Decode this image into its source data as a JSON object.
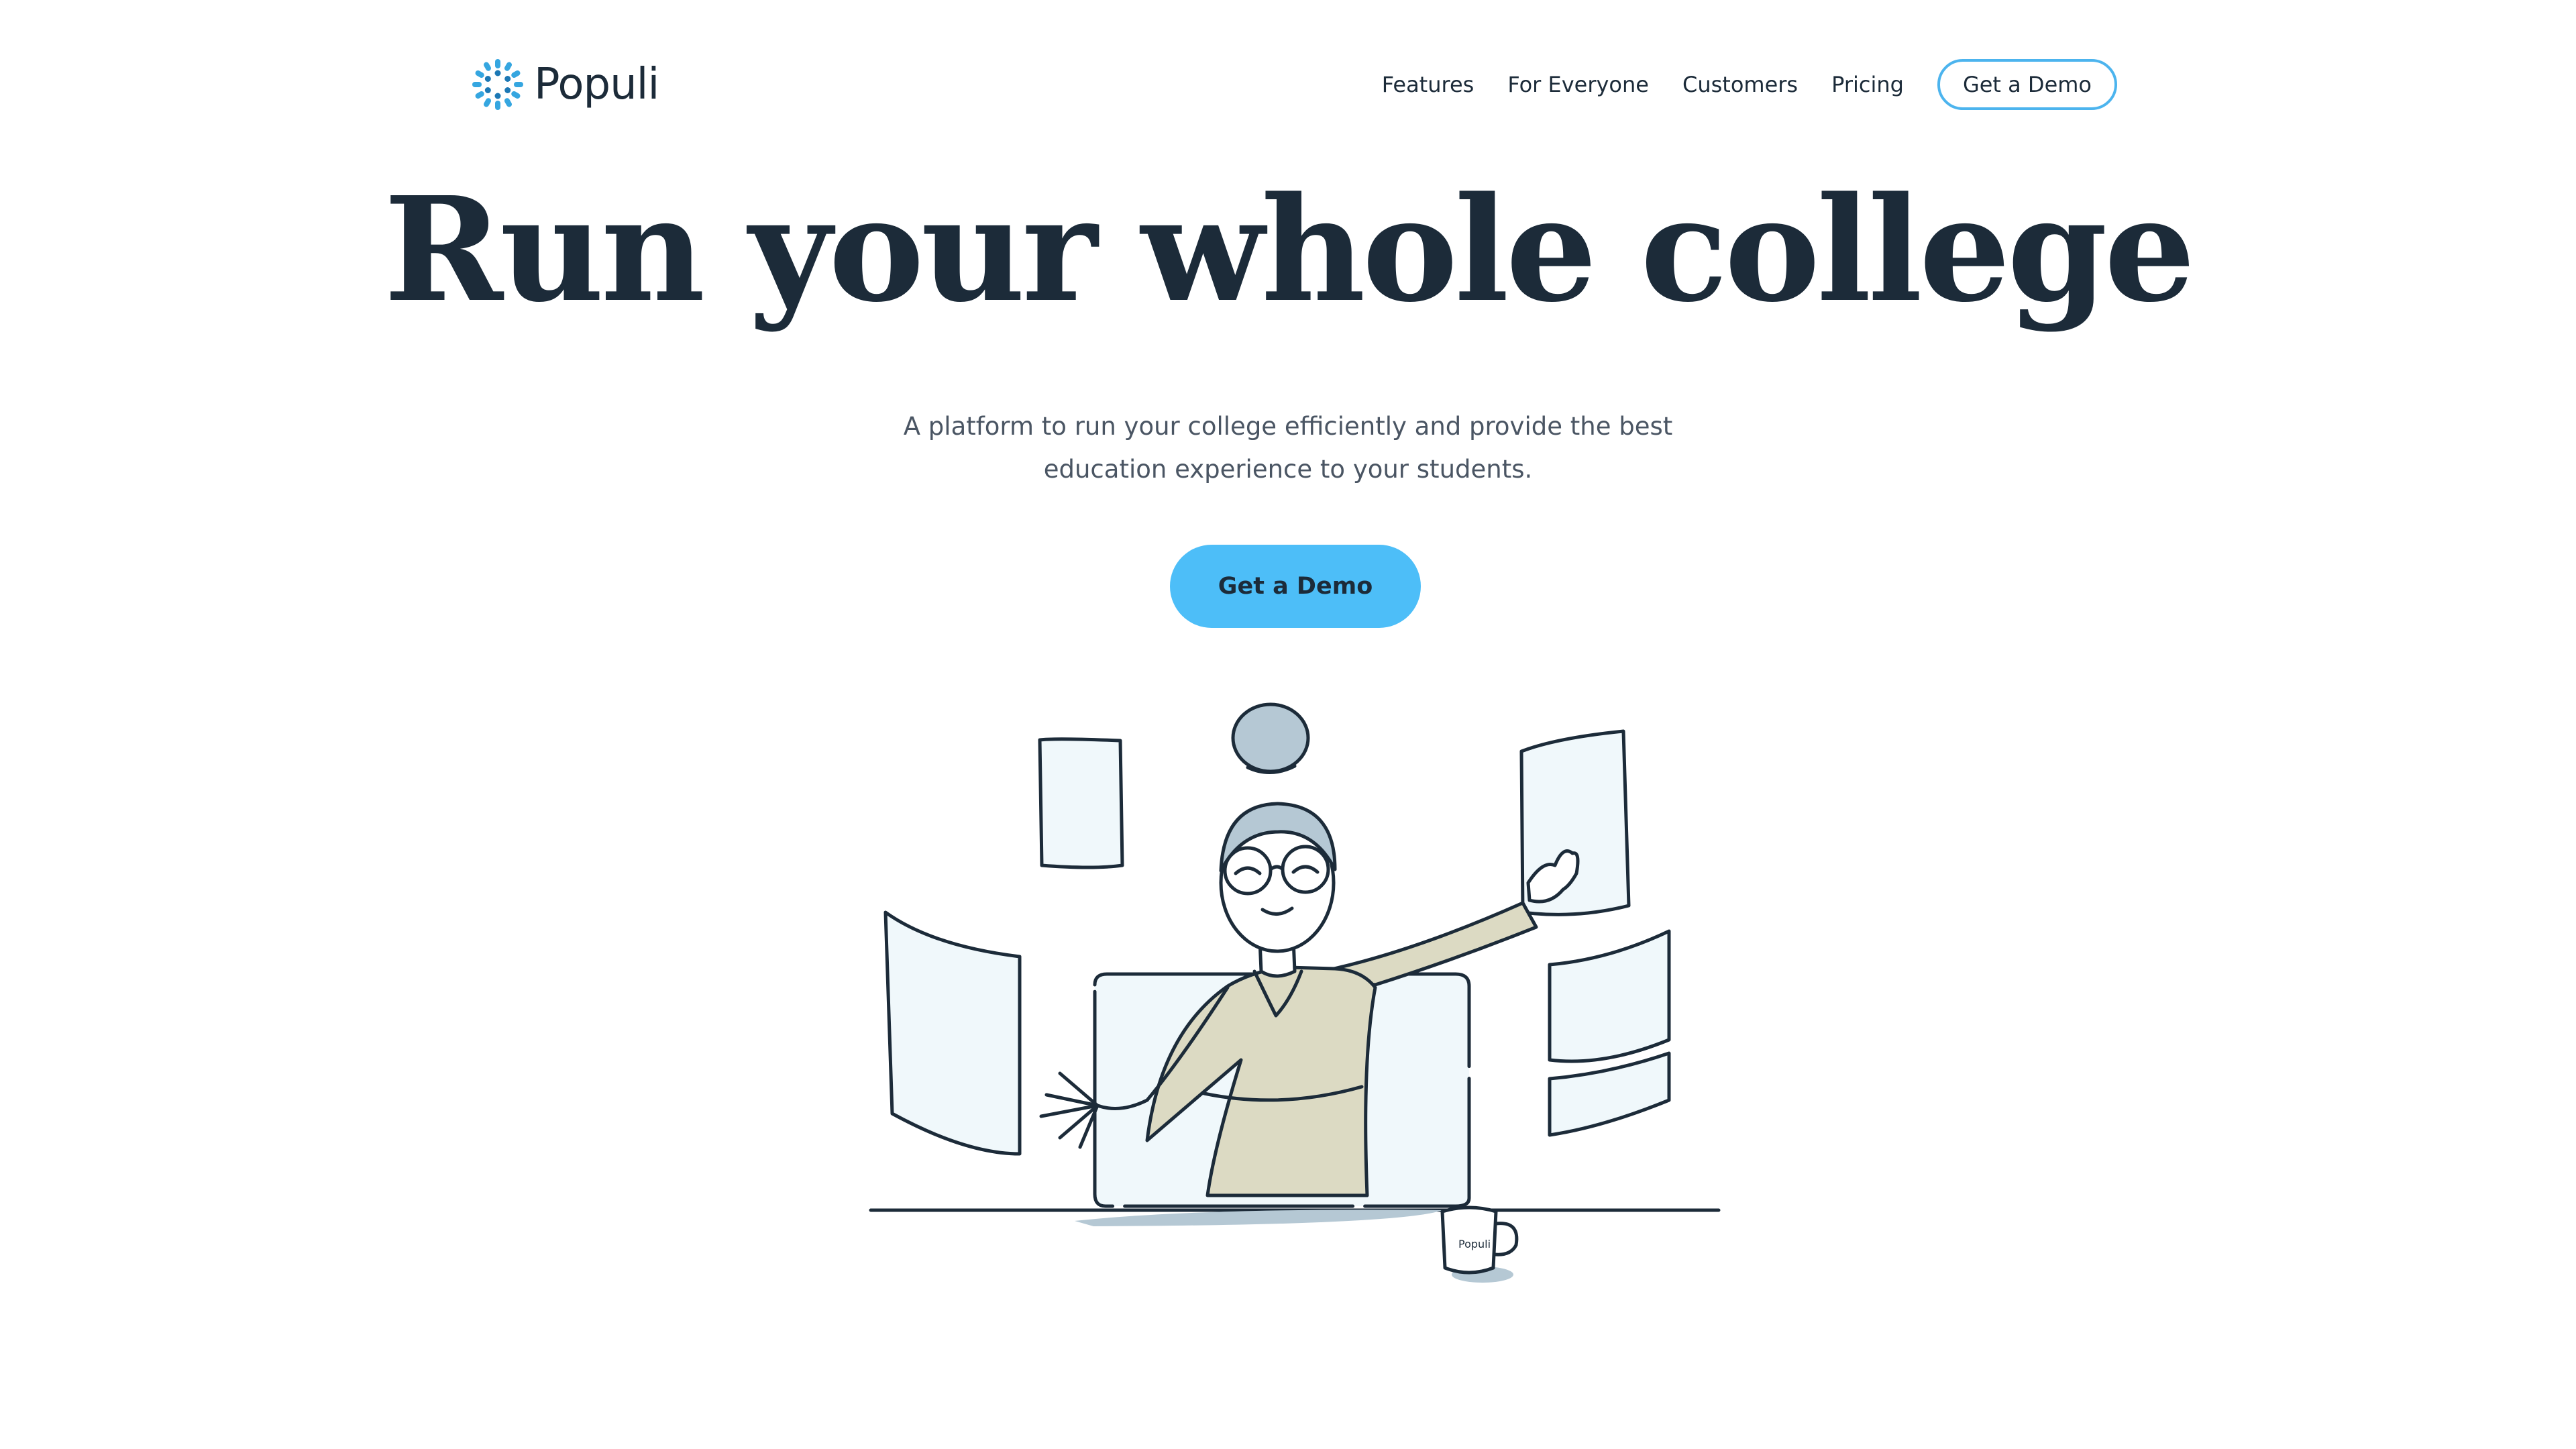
{
  "header": {
    "brand": "Populi",
    "nav": [
      "Features",
      "For Everyone",
      "Customers",
      "Pricing"
    ],
    "cta_label": "Get a Demo"
  },
  "hero": {
    "title": "Run your whole college",
    "subtitle_line1": "A platform to run your college efficiently and provide the best",
    "subtitle_line2": "education experience to your students.",
    "cta_label": "Get a Demo"
  },
  "illustration": {
    "mug_label": "Populi"
  },
  "colors": {
    "brand_blue": "#4dbef8",
    "cta_border": "#4cb4ee",
    "text_dark": "#1c2b39",
    "text_muted": "#4a5563",
    "panel_fill": "#f0f8fb",
    "sweater": "#dcdac3",
    "hair": "#b5c8d4"
  }
}
